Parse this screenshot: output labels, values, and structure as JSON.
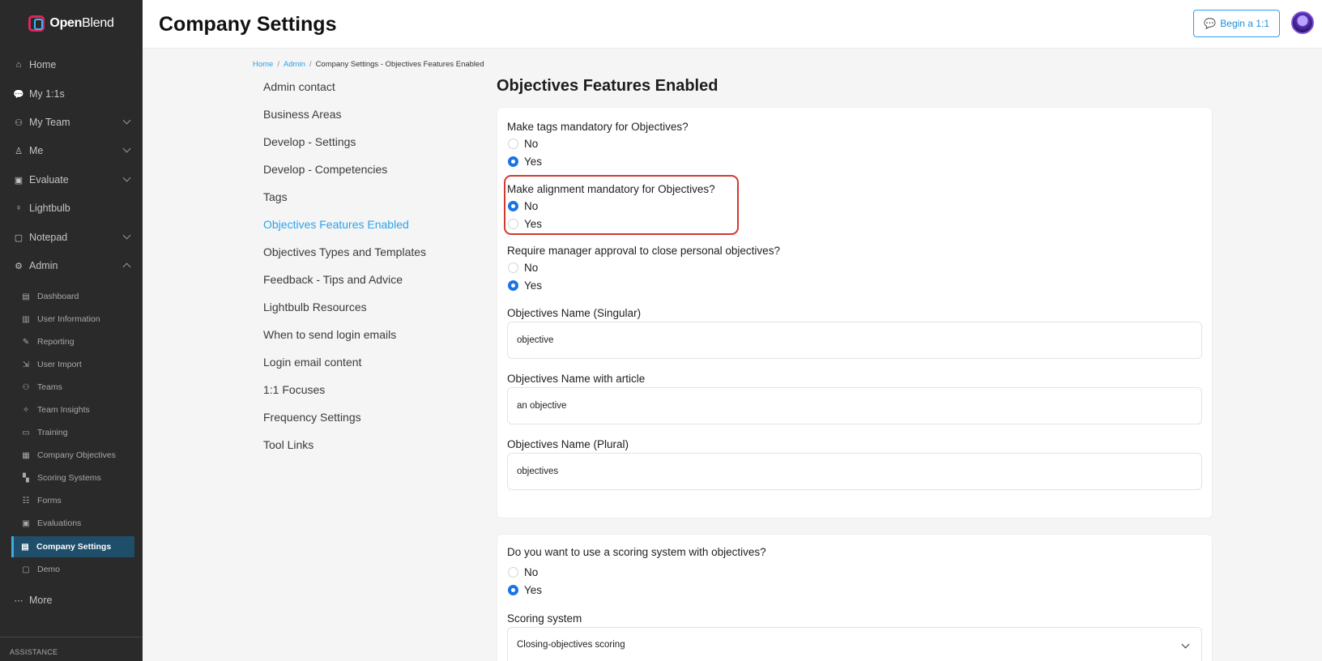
{
  "app": {
    "logo_bold": "Open",
    "logo_light": "Blend"
  },
  "header": {
    "title": "Company Settings",
    "begin_button": "Begin a 1:1"
  },
  "sidebar": {
    "items": [
      {
        "label": "Home",
        "icon": "home-icon"
      },
      {
        "label": "My 1:1s",
        "icon": "chat-icon"
      },
      {
        "label": "My Team",
        "icon": "team-icon"
      },
      {
        "label": "Me",
        "icon": "person-icon"
      },
      {
        "label": "Evaluate",
        "icon": "evaluate-icon"
      },
      {
        "label": "Lightbulb",
        "icon": "lightbulb-icon"
      },
      {
        "label": "Notepad",
        "icon": "notepad-icon"
      },
      {
        "label": "Admin",
        "icon": "gear-icon"
      }
    ],
    "admin_items": [
      {
        "label": "Dashboard",
        "icon": "dashboard-icon"
      },
      {
        "label": "User Information",
        "icon": "user-info-icon"
      },
      {
        "label": "Reporting",
        "icon": "reporting-icon"
      },
      {
        "label": "User Import",
        "icon": "user-import-icon"
      },
      {
        "label": "Teams",
        "icon": "teams-icon"
      },
      {
        "label": "Team Insights",
        "icon": "insights-icon"
      },
      {
        "label": "Training",
        "icon": "training-icon"
      },
      {
        "label": "Company Objectives",
        "icon": "objectives-icon"
      },
      {
        "label": "Scoring Systems",
        "icon": "scoring-icon"
      },
      {
        "label": "Forms",
        "icon": "forms-icon"
      },
      {
        "label": "Evaluations",
        "icon": "evaluations-icon"
      },
      {
        "label": "Company Settings",
        "icon": "settings-icon"
      },
      {
        "label": "Demo",
        "icon": "demo-icon"
      }
    ],
    "more": "More",
    "assistance": "ASSISTANCE"
  },
  "breadcrumb": {
    "home": "Home",
    "admin": "Admin",
    "current": "Company Settings - Objectives Features Enabled"
  },
  "settings_menu": [
    "Admin contact",
    "Business Areas",
    "Develop - Settings",
    "Develop - Competencies",
    "Tags",
    "Objectives Features Enabled",
    "Objectives Types and Templates",
    "Feedback - Tips and Advice",
    "Lightbulb Resources",
    "When to send login emails",
    "Login email content",
    "1:1 Focuses",
    "Frequency Settings",
    "Tool Links"
  ],
  "content": {
    "title": "Objectives Features Enabled",
    "q_tags": {
      "label": "Make tags mandatory for Objectives?",
      "no": "No",
      "yes": "Yes",
      "selected": "Yes"
    },
    "q_alignment": {
      "label": "Make alignment mandatory for Objectives?",
      "no": "No",
      "yes": "Yes",
      "selected": "No"
    },
    "q_approval": {
      "label": "Require manager approval to close personal objectives?",
      "no": "No",
      "yes": "Yes",
      "selected": "Yes"
    },
    "name_singular": {
      "label": "Objectives Name (Singular)",
      "value": "objective"
    },
    "name_article": {
      "label": "Objectives Name with article",
      "value": "an objective"
    },
    "name_plural": {
      "label": "Objectives Name (Plural)",
      "value": "objectives"
    },
    "q_scoring": {
      "label": "Do you want to use a scoring system with objectives?",
      "no": "No",
      "yes": "Yes",
      "selected": "Yes"
    },
    "scoring_system": {
      "label": "Scoring system",
      "value": "Closing-objectives scoring"
    }
  },
  "colors": {
    "accent": "#2da3ec",
    "radio_selected": "#1b74e4",
    "highlight": "#d23a2e",
    "sidebar_bg": "#2a2a2a"
  }
}
